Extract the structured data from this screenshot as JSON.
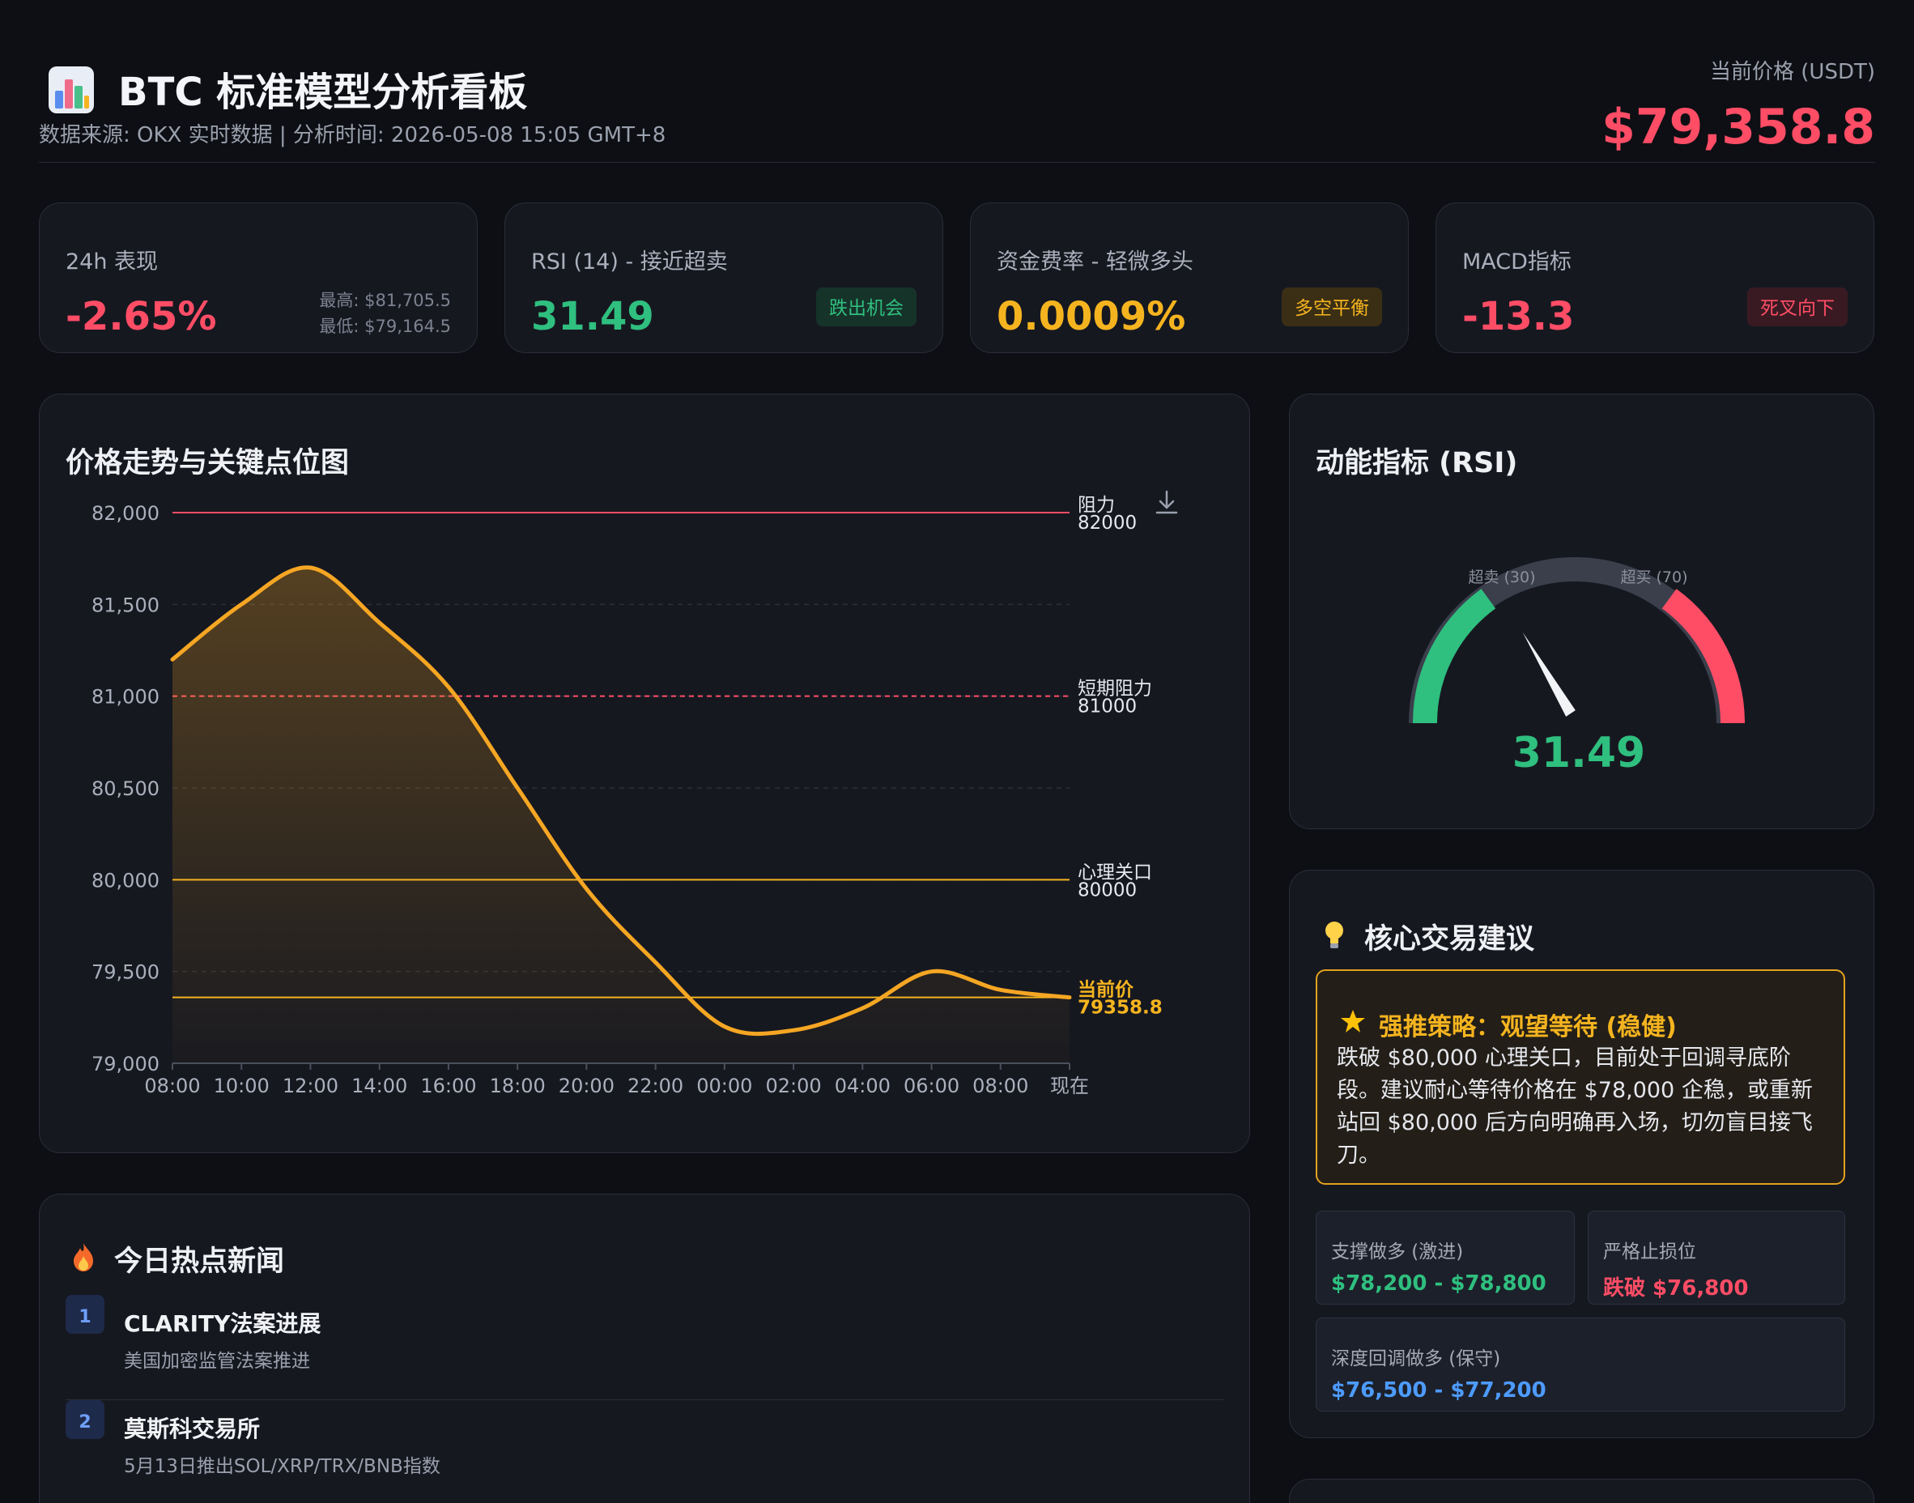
{
  "header": {
    "title": "BTC 标准模型分析看板",
    "subtitle": "数据来源: OKX 实时数据 | 分析时间: 2026-05-08 15:05 GMT+8",
    "price_label": "当前价格 (USDT)",
    "price_value": "$79,358.8",
    "logo_icon": "bar-chart-icon"
  },
  "stats": [
    {
      "label": "24h 表现",
      "value": "-2.65%",
      "color": "#ff4d66",
      "high": "最高: $81,705.5",
      "low": "最低: $79,164.5"
    },
    {
      "label": "RSI (14) - 接近超卖",
      "value": "31.49",
      "color": "#2fbf7f",
      "badge": "跌出机会",
      "badge_color": "#2fbf7f",
      "badge_bg": "#16332a"
    },
    {
      "label": "资金费率 - 轻微多头",
      "value": "0.0009%",
      "color": "#f5b41f",
      "badge": "多空平衡",
      "badge_color": "#f5b41f",
      "badge_bg": "#3a2e14"
    },
    {
      "label": "MACD指标",
      "value": "-13.3",
      "color": "#ff4d66",
      "badge": "死叉向下",
      "badge_color": "#ff4d66",
      "badge_bg": "#3a1a22"
    }
  ],
  "price_chart": {
    "title": "价格走势与关键点位图",
    "download_icon": "download-icon"
  },
  "chart_data": {
    "type": "line",
    "x": [
      "08:00",
      "10:00",
      "12:00",
      "14:00",
      "16:00",
      "18:00",
      "20:00",
      "22:00",
      "00:00",
      "02:00",
      "04:00",
      "06:00",
      "08:00",
      "现在"
    ],
    "series": [
      {
        "values": [
          81200,
          81500,
          81700,
          81400,
          81050,
          80500,
          79950,
          79550,
          79200,
          79180,
          79300,
          79500,
          79400,
          79358.8
        ],
        "color": "#f5a623"
      }
    ],
    "ylim": [
      79000,
      82000
    ],
    "yticks": [
      "82,000",
      "81,500",
      "81,000",
      "80,500",
      "80,000",
      "79,500",
      "79,000"
    ],
    "reference_lines": [
      {
        "name": "阻力",
        "value": 82000,
        "label": "82000",
        "color": "#ff4d66",
        "style": "solid"
      },
      {
        "name": "短期阻力",
        "value": 81000,
        "label": "81000",
        "color": "#ff4d66",
        "style": "dashed"
      },
      {
        "name": "心理关口",
        "value": 80000,
        "label": "80000",
        "color": "#f5b41f",
        "style": "solid"
      },
      {
        "name": "当前价",
        "value": 79358.8,
        "label": "79358.8",
        "color": "#f5b41f",
        "style": "solid"
      }
    ],
    "grid": true
  },
  "rsi": {
    "title": "动能指标 (RSI)",
    "value": 31.49,
    "value_text": "31.49",
    "oversold_label": "超卖 (30)",
    "overbought_label": "超买 (70)"
  },
  "news": {
    "title": "今日热点新闻",
    "icon": "fire-icon",
    "items": [
      {
        "num": "1",
        "title": "CLARITY法案进展",
        "desc": "美国加密监管法案推进"
      },
      {
        "num": "2",
        "title": "莫斯科交易所",
        "desc": "5月13日推出SOL/XRP/TRX/BNB指数"
      }
    ]
  },
  "advice": {
    "title": "核心交易建议",
    "icon": "lightbulb-icon",
    "strategy_icon": "star-icon",
    "strategy_title": "强推策略：观望等待 (稳健)",
    "strategy_text": "跌破 $80,000 心理关口，目前处于回调寻底阶段。建议耐心等待价格在 $78,000 企稳，或重新站回 $80,000 后方向明确再入场，切勿盲目接飞刀。",
    "levels": [
      {
        "label": "支撑做多 (激进)",
        "value": "$78,200 - $78,800",
        "color": "#2fbf7f"
      },
      {
        "label": "严格止损位",
        "value": "跌破 $76,800",
        "color": "#ff4d66"
      },
      {
        "label": "深度回调做多 (保守)",
        "value": "$76,500 - $77,200",
        "color": "#4d9bff"
      }
    ]
  }
}
